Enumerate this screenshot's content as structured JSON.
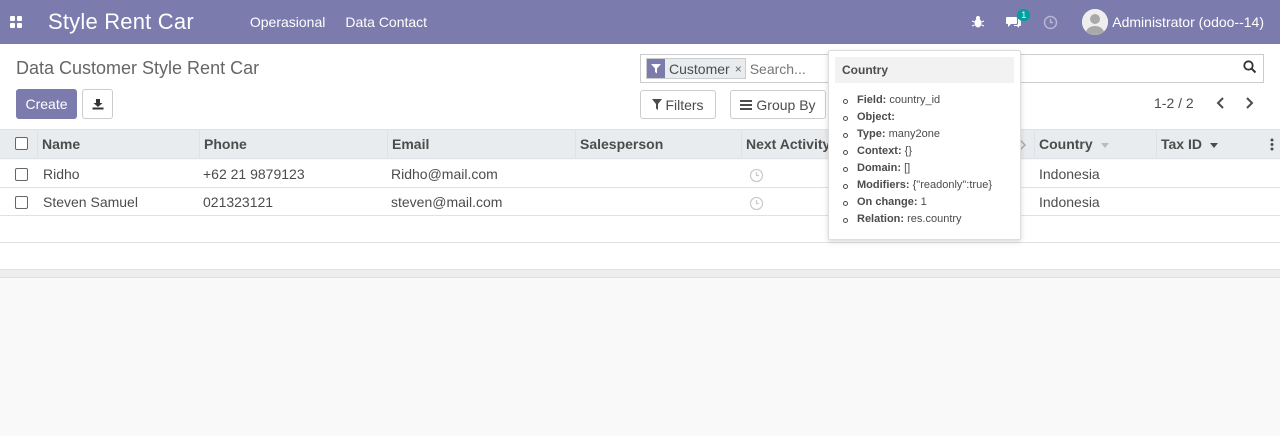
{
  "navbar": {
    "brand": "Style Rent Car",
    "menu": [
      "Operasional",
      "Data Contact"
    ],
    "messages_count": "1",
    "user_name": "Administrator (odoo--14)"
  },
  "control_panel": {
    "breadcrumb": "Data Customer Style Rent Car",
    "create_label": "Create",
    "search": {
      "facet_value": "Customer",
      "facet_remove": "×",
      "placeholder": "Search..."
    },
    "filters_label": "Filters",
    "group_by_label": "Group By",
    "pager": "1-2 / 2"
  },
  "table": {
    "columns": [
      "Name",
      "Phone",
      "Email",
      "Salesperson",
      "Next Activity",
      "Country",
      "Tax ID"
    ],
    "rows": [
      {
        "name": "Ridho",
        "phone": "+62 21 9879123",
        "email": "Ridho@mail.com",
        "salesperson": "",
        "country": "Indonesia",
        "tax_id": ""
      },
      {
        "name": "Steven Samuel",
        "phone": "021323121",
        "email": "steven@mail.com",
        "salesperson": "",
        "country": "Indonesia",
        "tax_id": ""
      }
    ]
  },
  "tooltip": {
    "title": "Country",
    "items": [
      {
        "label": "Field:",
        "value": "country_id"
      },
      {
        "label": "Object:",
        "value": ""
      },
      {
        "label": "Type:",
        "value": "many2one"
      },
      {
        "label": "Context:",
        "value": "{}"
      },
      {
        "label": "Domain:",
        "value": "[]"
      },
      {
        "label": "Modifiers:",
        "value": "{\"readonly\":true}"
      },
      {
        "label": "On change:",
        "value": "1"
      },
      {
        "label": "Relation:",
        "value": "res.country"
      }
    ]
  },
  "colors": {
    "primary": "#7c7bad",
    "badge": "#00a09d"
  }
}
